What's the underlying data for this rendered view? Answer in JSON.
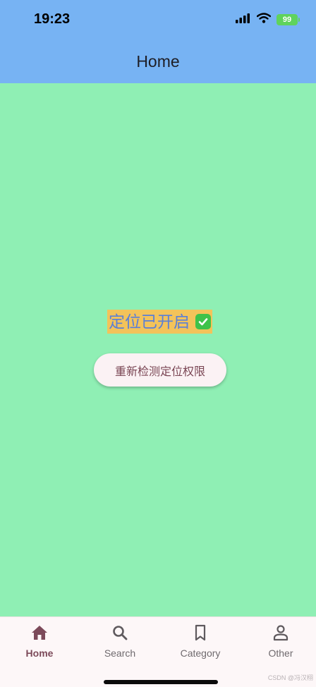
{
  "status_bar": {
    "time": "19:23",
    "battery": "99"
  },
  "app_bar": {
    "title": "Home"
  },
  "main": {
    "status_text": "定位已开启",
    "recheck_button": "重新检测定位权限"
  },
  "bottom_nav": {
    "items": [
      {
        "label": "Home",
        "icon": "home-icon",
        "active": true
      },
      {
        "label": "Search",
        "icon": "search-icon",
        "active": false
      },
      {
        "label": "Category",
        "icon": "bookmark-icon",
        "active": false
      },
      {
        "label": "Other",
        "icon": "person-icon",
        "active": false
      }
    ]
  },
  "watermark": "CSDN @冯汉栩",
  "colors": {
    "app_bar": "#77b3f3",
    "background": "#8fefb4",
    "highlight": "#f3c35a",
    "accent": "#7c4a5a"
  }
}
